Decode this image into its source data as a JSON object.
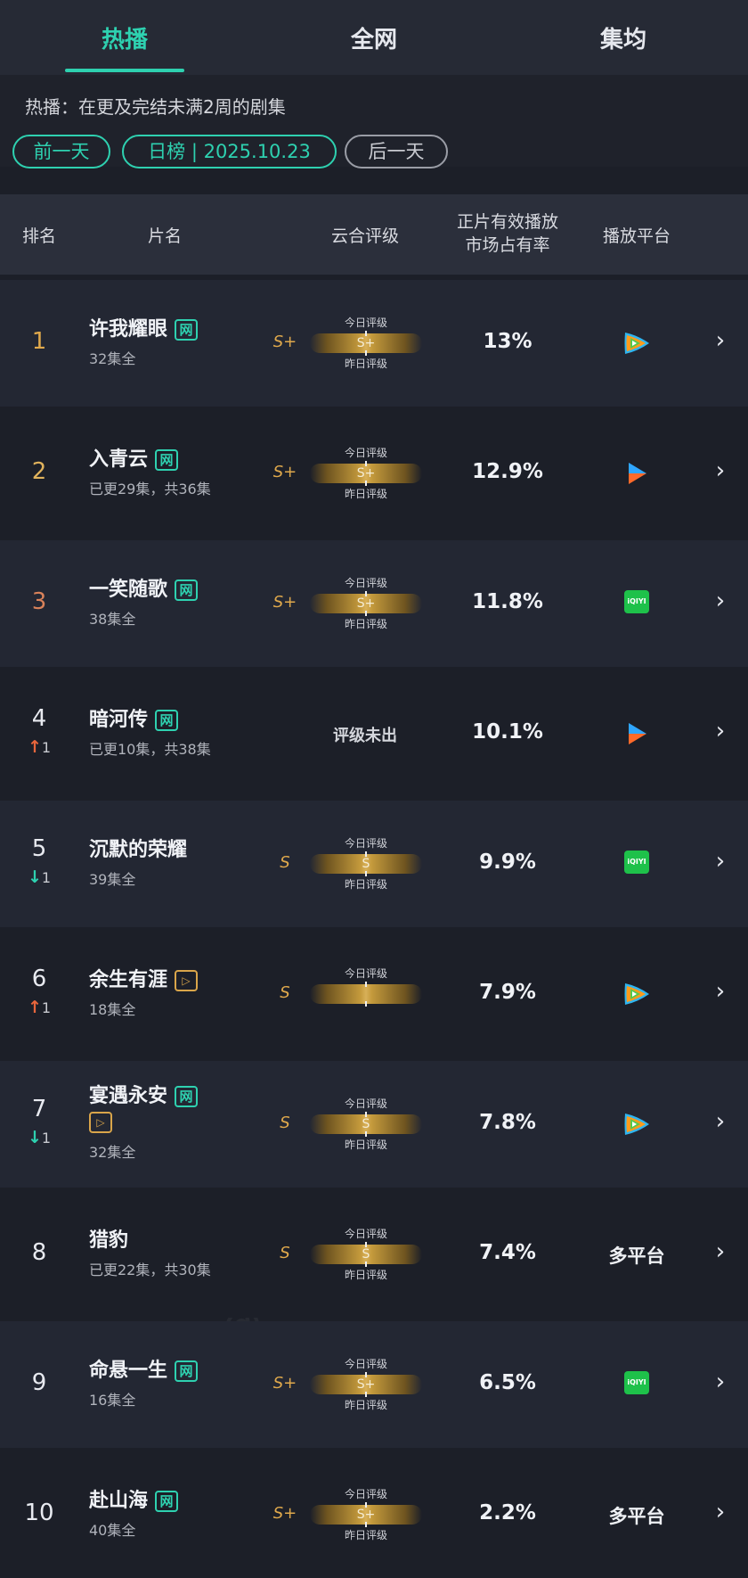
{
  "tabs": [
    {
      "label": "热播",
      "active": true
    },
    {
      "label": "全网",
      "active": false
    },
    {
      "label": "集均",
      "active": false
    }
  ],
  "description": "热播：在更及完结未满2周的剧集",
  "date_nav": {
    "prev": "前一天",
    "current": "日榜 | 2025.10.23",
    "next": "后一天"
  },
  "columns": {
    "rank": "排名",
    "name": "片名",
    "rating": "云合评级",
    "share": "正片有效播放\n市场占有率",
    "platform": "播放平台"
  },
  "grade_labels": {
    "today": "今日评级",
    "yesterday": "昨日评级",
    "not_out": "评级未出"
  },
  "badges": {
    "network": "网",
    "free": "▷"
  },
  "accent_color": "#2ed1b0",
  "rows": [
    {
      "rank": "1",
      "rank_color": "#e0a94c",
      "trend_dir": "",
      "trend_num": "",
      "title": "许我耀眼",
      "badges": [
        "network"
      ],
      "episodes": "32集全",
      "grade_yesterday": "S+",
      "grade_today": "S+",
      "show_yesterday_label": true,
      "share": "13%",
      "platform": "tencent-video-icon",
      "platform_text": ""
    },
    {
      "rank": "2",
      "rank_color": "#e0b25c",
      "trend_dir": "",
      "trend_num": "",
      "title": "入青云",
      "badges": [
        "network"
      ],
      "episodes": "已更29集，共36集",
      "grade_yesterday": "S+",
      "grade_today": "S+",
      "show_yesterday_label": true,
      "share": "12.9%",
      "platform": "youku-icon",
      "platform_text": ""
    },
    {
      "rank": "3",
      "rank_color": "#d9825a",
      "trend_dir": "",
      "trend_num": "",
      "title": "一笑随歌",
      "badges": [
        "network"
      ],
      "episodes": "38集全",
      "grade_yesterday": "S+",
      "grade_today": "S+",
      "show_yesterday_label": true,
      "share": "11.8%",
      "platform": "iqiyi-icon",
      "platform_text": ""
    },
    {
      "rank": "4",
      "rank_color": "#e8eaf0",
      "trend_dir": "up",
      "trend_num": "1",
      "title": "暗河传",
      "badges": [
        "network"
      ],
      "episodes": "已更10集，共38集",
      "grade_yesterday": "",
      "grade_today": "",
      "show_yesterday_label": false,
      "share": "10.1%",
      "platform": "youku-icon",
      "platform_text": ""
    },
    {
      "rank": "5",
      "rank_color": "#e8eaf0",
      "trend_dir": "down",
      "trend_num": "1",
      "title": "沉默的荣耀",
      "badges": [],
      "episodes": "39集全",
      "grade_yesterday": "S",
      "grade_today": "S",
      "show_yesterday_label": true,
      "share": "9.9%",
      "platform": "iqiyi-icon",
      "platform_text": ""
    },
    {
      "rank": "6",
      "rank_color": "#e8eaf0",
      "trend_dir": "up",
      "trend_num": "1",
      "title": "余生有涯",
      "badges": [
        "free"
      ],
      "episodes": "18集全",
      "grade_yesterday": "S",
      "grade_today": "",
      "show_yesterday_label": false,
      "share": "7.9%",
      "platform": "tencent-video-icon",
      "platform_text": ""
    },
    {
      "rank": "7",
      "rank_color": "#e8eaf0",
      "trend_dir": "down",
      "trend_num": "1",
      "title": "宴遇永安",
      "badges": [
        "network",
        "free"
      ],
      "episodes": "32集全",
      "grade_yesterday": "S",
      "grade_today": "S",
      "show_yesterday_label": true,
      "share": "7.8%",
      "platform": "tencent-video-icon",
      "platform_text": ""
    },
    {
      "rank": "8",
      "rank_color": "#e8eaf0",
      "trend_dir": "",
      "trend_num": "",
      "title": "猎豹",
      "badges": [],
      "episodes": "已更22集，共30集",
      "grade_yesterday": "S",
      "grade_today": "S",
      "show_yesterday_label": true,
      "share": "7.4%",
      "platform": "",
      "platform_text": "多平台"
    },
    {
      "rank": "9",
      "rank_color": "#e8eaf0",
      "trend_dir": "",
      "trend_num": "",
      "title": "命悬一生",
      "badges": [
        "network"
      ],
      "episodes": "16集全",
      "grade_yesterday": "S+",
      "grade_today": "S+",
      "show_yesterday_label": true,
      "share": "6.5%",
      "platform": "iqiyi-icon",
      "platform_text": ""
    },
    {
      "rank": "10",
      "rank_color": "#e8eaf0",
      "trend_dir": "",
      "trend_num": "",
      "title": "赴山海",
      "badges": [
        "network"
      ],
      "episodes": "40集全",
      "grade_yesterday": "S+",
      "grade_today": "S+",
      "show_yesterday_label": true,
      "share": "2.2%",
      "platform": "",
      "platform_text": "多平台"
    }
  ],
  "iqiyi_text": "iQIYI"
}
